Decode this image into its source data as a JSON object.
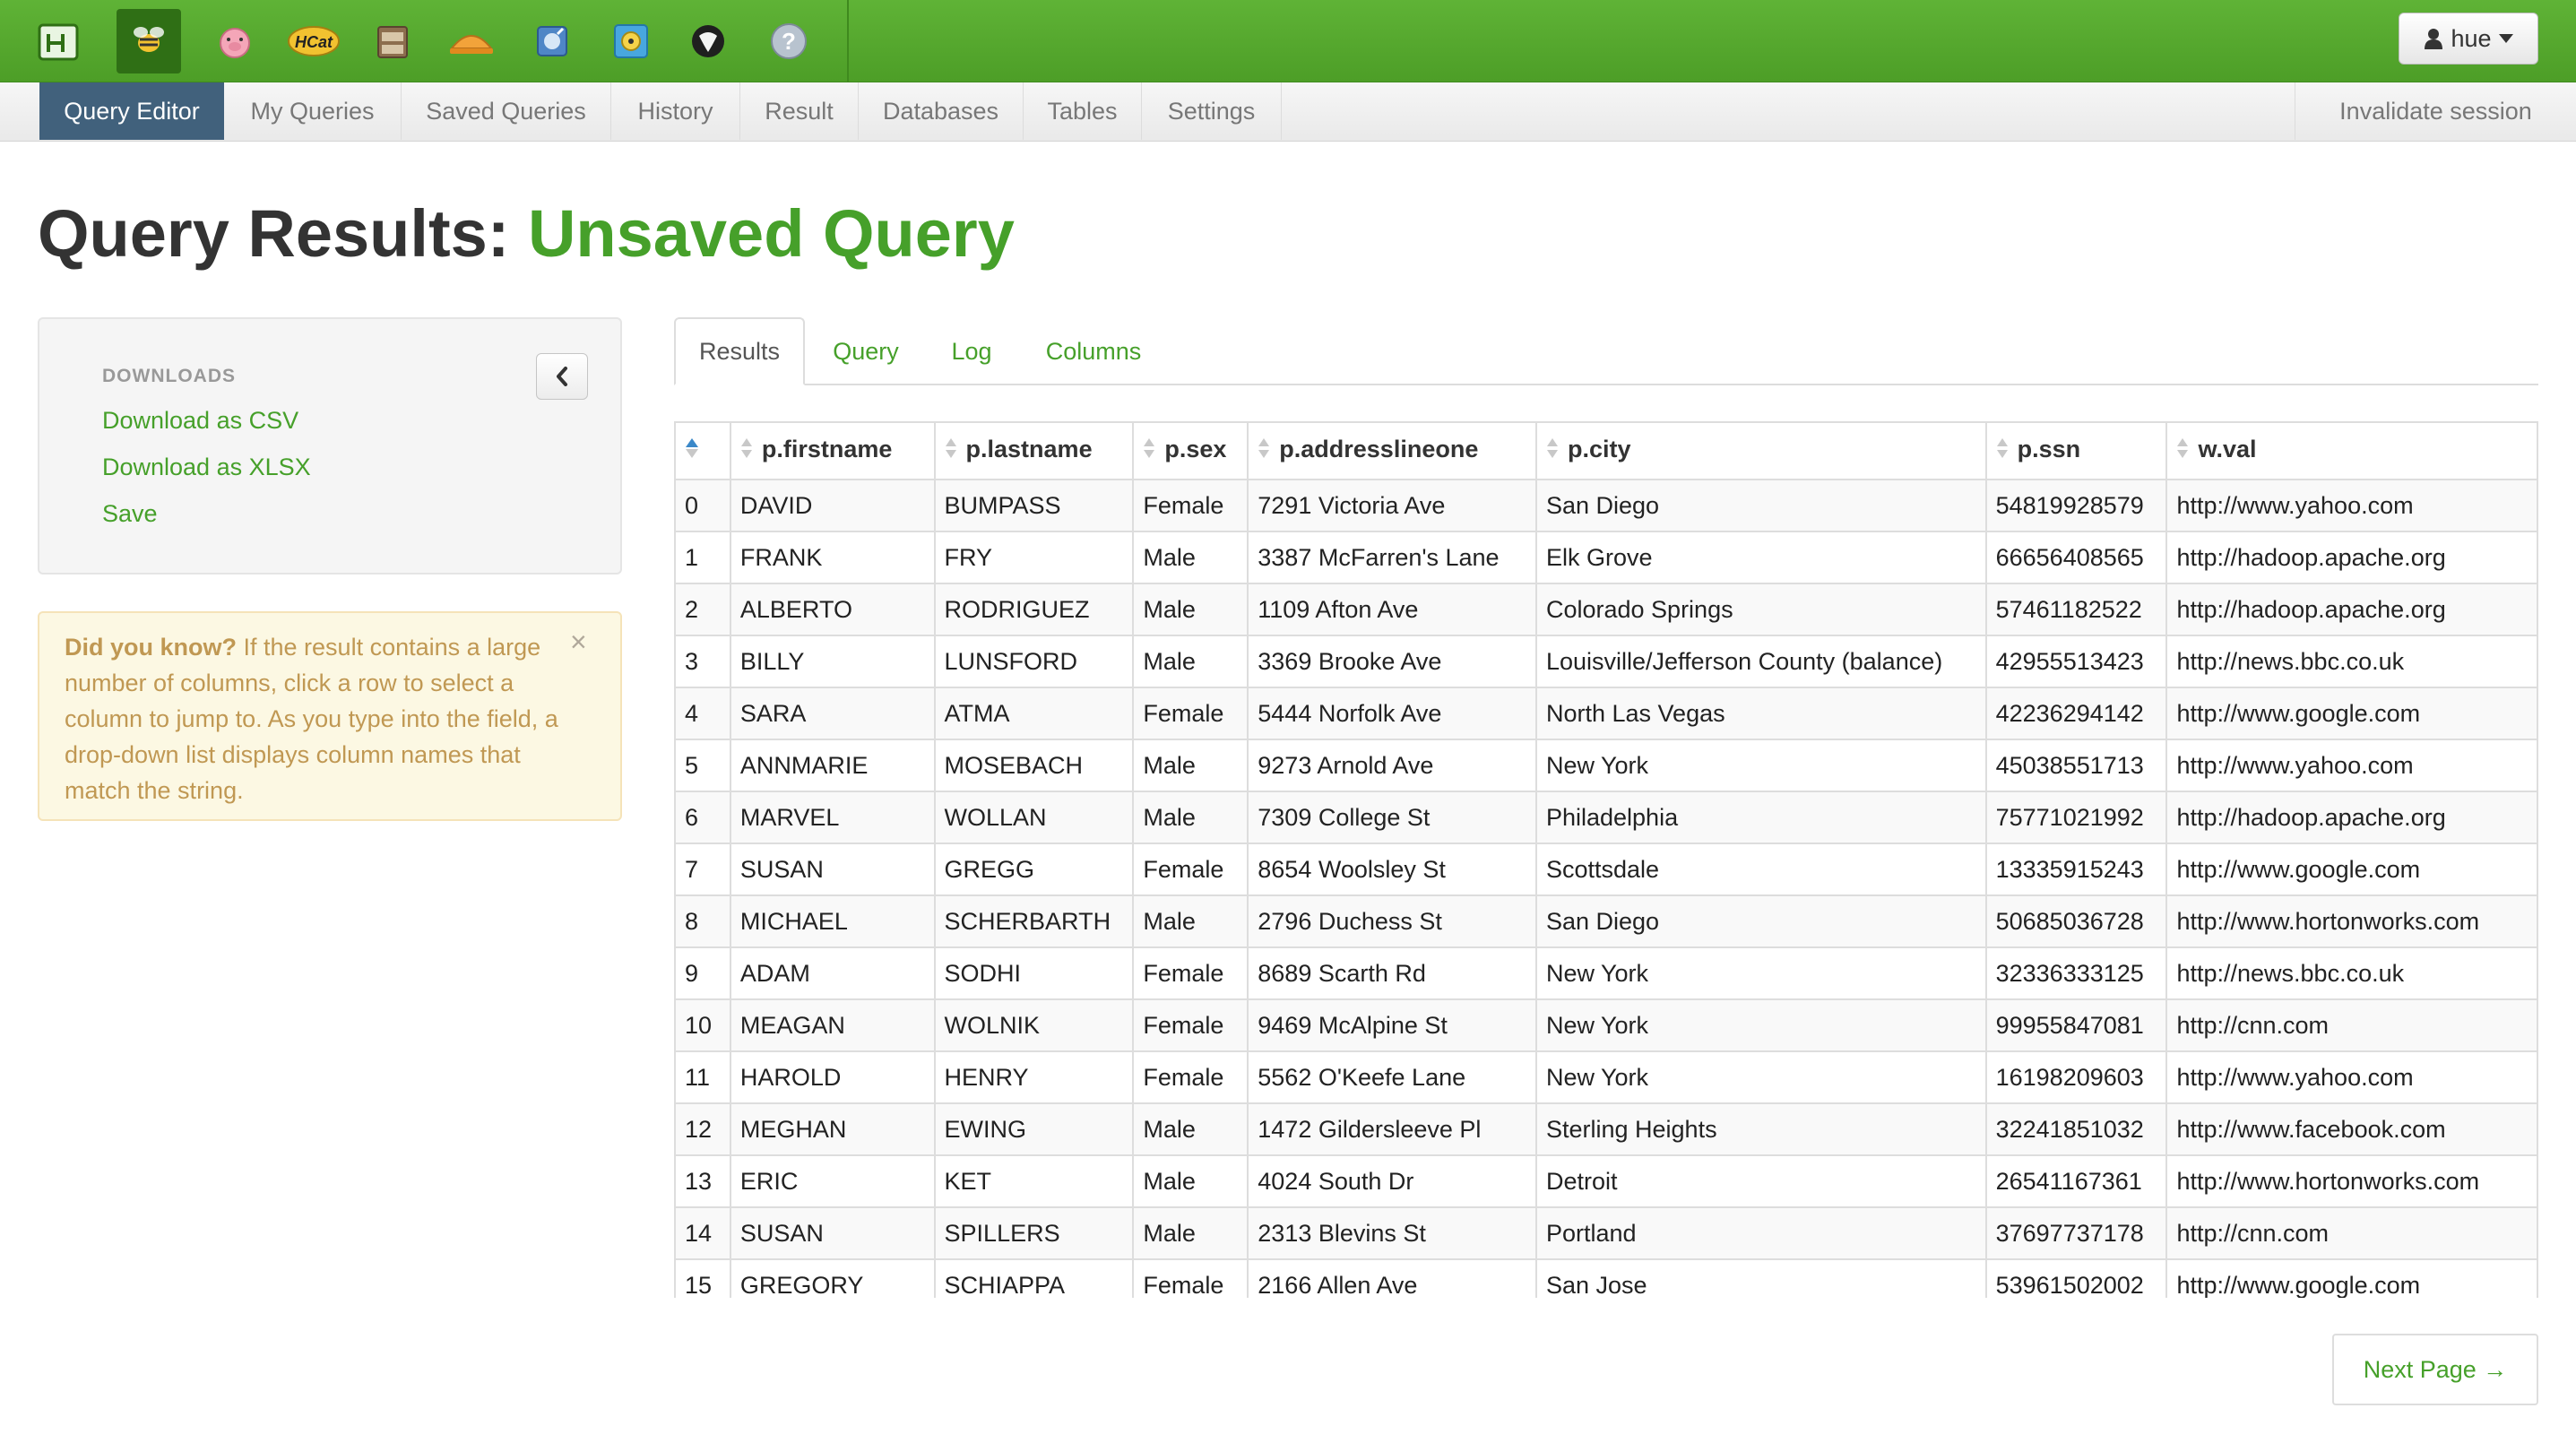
{
  "topbar": {
    "apps": [
      {
        "icon": "hue-logo-icon"
      },
      {
        "icon": "beeswax-icon"
      },
      {
        "icon": "pig-icon"
      },
      {
        "icon": "hcat-icon",
        "label": "HCat"
      },
      {
        "icon": "file-browser-icon"
      },
      {
        "icon": "job-designer-icon"
      },
      {
        "icon": "oozie-icon"
      },
      {
        "icon": "job-browser-icon"
      },
      {
        "icon": "shell-icon"
      },
      {
        "icon": "help-icon"
      }
    ],
    "user_label": "hue",
    "accent_color": "#4d9e27"
  },
  "subnav": {
    "items": [
      {
        "label": "Query Editor",
        "active": true
      },
      {
        "label": "My Queries"
      },
      {
        "label": "Saved Queries"
      },
      {
        "label": "History"
      },
      {
        "label": "Result"
      },
      {
        "label": "Databases"
      },
      {
        "label": "Tables"
      },
      {
        "label": "Settings"
      }
    ],
    "invalidate_label": "Invalidate session"
  },
  "title": {
    "prefix": "Query Results:",
    "name": "Unsaved Query"
  },
  "sidebar": {
    "downloads_header": "DOWNLOADS",
    "links": [
      "Download as CSV",
      "Download as XLSX",
      "Save"
    ],
    "tip_bold": "Did you know?",
    "tip_text": " If the result contains a large number of columns, click a row to select a column to jump to. As you type into the field, a drop-down list displays column names that match the string."
  },
  "tabs": [
    "Results",
    "Query",
    "Log",
    "Columns"
  ],
  "table": {
    "columns": [
      "",
      "p.firstname",
      "p.lastname",
      "p.sex",
      "p.addresslineone",
      "p.city",
      "p.ssn",
      "w.val"
    ],
    "rows": [
      [
        "0",
        "DAVID",
        "BUMPASS",
        "Female",
        "7291 Victoria Ave",
        "San Diego",
        "54819928579",
        "http://www.yahoo.com"
      ],
      [
        "1",
        "FRANK",
        "FRY",
        "Male",
        "3387 McFarren's Lane",
        "Elk Grove",
        "66656408565",
        "http://hadoop.apache.org"
      ],
      [
        "2",
        "ALBERTO",
        "RODRIGUEZ",
        "Male",
        "1109 Afton Ave",
        "Colorado Springs",
        "57461182522",
        "http://hadoop.apache.org"
      ],
      [
        "3",
        "BILLY",
        "LUNSFORD",
        "Male",
        "3369 Brooke Ave",
        "Louisville/Jefferson County (balance)",
        "42955513423",
        "http://news.bbc.co.uk"
      ],
      [
        "4",
        "SARA",
        "ATMA",
        "Female",
        "5444 Norfolk Ave",
        "North Las Vegas",
        "42236294142",
        "http://www.google.com"
      ],
      [
        "5",
        "ANNMARIE",
        "MOSEBACH",
        "Male",
        "9273 Arnold Ave",
        "New York",
        "45038551713",
        "http://www.yahoo.com"
      ],
      [
        "6",
        "MARVEL",
        "WOLLAN",
        "Male",
        "7309 College St",
        "Philadelphia",
        "75771021992",
        "http://hadoop.apache.org"
      ],
      [
        "7",
        "SUSAN",
        "GREGG",
        "Female",
        "8654 Woolsley St",
        "Scottsdale",
        "13335915243",
        "http://www.google.com"
      ],
      [
        "8",
        "MICHAEL",
        "SCHERBARTH",
        "Male",
        "2796 Duchess St",
        "San Diego",
        "50685036728",
        "http://www.hortonworks.com"
      ],
      [
        "9",
        "ADAM",
        "SODHI",
        "Female",
        "8689 Scarth Rd",
        "New York",
        "32336333125",
        "http://news.bbc.co.uk"
      ],
      [
        "10",
        "MEAGAN",
        "WOLNIK",
        "Female",
        "9469 McAlpine St",
        "New York",
        "99955847081",
        "http://cnn.com"
      ],
      [
        "11",
        "HAROLD",
        "HENRY",
        "Female",
        "5562 O'Keefe Lane",
        "New York",
        "16198209603",
        "http://www.yahoo.com"
      ],
      [
        "12",
        "MEGHAN",
        "EWING",
        "Male",
        "1472 Gildersleeve Pl",
        "Sterling Heights",
        "32241851032",
        "http://www.facebook.com"
      ],
      [
        "13",
        "ERIC",
        "KET",
        "Male",
        "4024 South Dr",
        "Detroit",
        "26541167361",
        "http://www.hortonworks.com"
      ],
      [
        "14",
        "SUSAN",
        "SPILLERS",
        "Male",
        "2313 Blevins St",
        "Portland",
        "37697737178",
        "http://cnn.com"
      ],
      [
        "15",
        "GREGORY",
        "SCHIAPPA",
        "Female",
        "2166 Allen Ave",
        "San Jose",
        "53961502002",
        "http://www.google.com"
      ]
    ]
  },
  "pager": {
    "next_label": "Next Page →"
  }
}
